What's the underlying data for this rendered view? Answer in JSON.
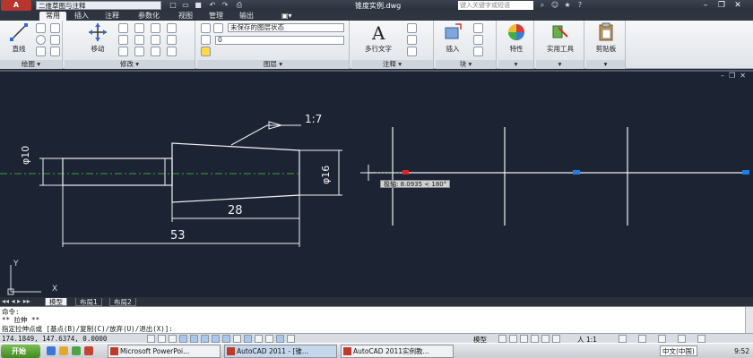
{
  "titlebar": {
    "logo": "A",
    "workspace": "二维草图与注释",
    "document": "锥度实例.dwg",
    "search_placeholder": "键入关键字或短语"
  },
  "ribbon_tabs": [
    "常用",
    "插入",
    "注释",
    "参数化",
    "视图",
    "管理",
    "输出"
  ],
  "ribbon": {
    "draw": {
      "label": "绘图",
      "line": "直线"
    },
    "modify": {
      "label": "修改",
      "move": "移动"
    },
    "layers": {
      "label": "图层",
      "layer_state": "未保存的图层状态",
      "current_layer": "0"
    },
    "annotation": {
      "label": "注释",
      "mtext": "多行文字"
    },
    "block": {
      "label": "块",
      "insert": "插入"
    },
    "properties": {
      "label": "特性"
    },
    "utilities": {
      "label": "实用工具"
    },
    "clipboard": {
      "label": "剪贴板"
    }
  },
  "drawing": {
    "taper_label": "1:7",
    "dim_left_dia": "φ10",
    "dim_right_dia": "φ16",
    "dim_28": "28",
    "dim_53": "53",
    "cursor_tooltip": "极轴: 8.0935 < 180°",
    "ucs_x": "X",
    "ucs_y": "Y"
  },
  "layout_tabs": [
    "模型",
    "布局1",
    "布局2"
  ],
  "command_line": {
    "line1": "命令:",
    "line2": "** 拉伸 **",
    "line3": "指定拉伸点或 [基点(B)/复制(C)/放弃(U)/退出(X)]:"
  },
  "status": {
    "coords": "174.1849, 147.6374, 0.0000",
    "model": "模型",
    "scale": "人 1:1"
  },
  "taskbar": {
    "start": "开始",
    "tasks": [
      "Microsoft PowerPoi...",
      "AutoCAD 2011 - [锥...",
      "AutoCAD 2011实例教..."
    ],
    "language": "中文(中国)",
    "clock": "9:52"
  }
}
